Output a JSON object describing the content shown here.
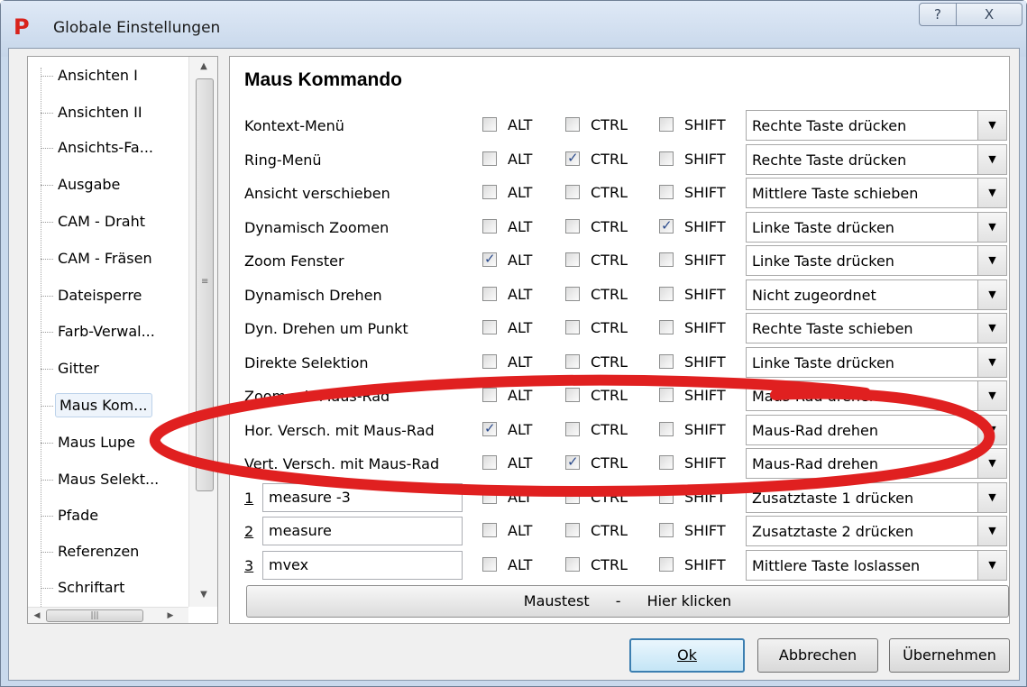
{
  "window": {
    "title": "Globale Einstellungen",
    "app_icon": "P",
    "help_glyph": "?",
    "close_glyph": "X"
  },
  "tree": {
    "items": [
      "Ansichten I",
      "Ansichten II",
      "Ansichts-Fa...",
      "Ausgabe",
      "CAM - Draht",
      "CAM - Fräsen",
      "Dateisperre",
      "Farb-Verwal...",
      "Gitter",
      "Maus Kom...",
      "Maus Lupe",
      "Maus Selekt...",
      "Pfade",
      "Referenzen",
      "Schriftart"
    ],
    "selected_index": 9
  },
  "panel": {
    "title": "Maus Kommando",
    "mod_labels": {
      "alt": "ALT",
      "ctrl": "CTRL",
      "shift": "SHIFT"
    },
    "rows": [
      {
        "label": "Kontext-Menü",
        "alt": false,
        "ctrl": false,
        "shift": false,
        "action": "Rechte Taste drücken"
      },
      {
        "label": "Ring-Menü",
        "alt": false,
        "ctrl": true,
        "shift": false,
        "action": "Rechte Taste drücken"
      },
      {
        "label": "Ansicht verschieben",
        "alt": false,
        "ctrl": false,
        "shift": false,
        "action": "Mittlere Taste schieben"
      },
      {
        "label": "Dynamisch Zoomen",
        "alt": false,
        "ctrl": false,
        "shift": true,
        "action": "Linke Taste drücken"
      },
      {
        "label": "Zoom Fenster",
        "alt": true,
        "ctrl": false,
        "shift": false,
        "action": "Linke Taste drücken"
      },
      {
        "label": "Dynamisch Drehen",
        "alt": false,
        "ctrl": false,
        "shift": false,
        "action": "Nicht zugeordnet"
      },
      {
        "label": "Dyn. Drehen um Punkt",
        "alt": false,
        "ctrl": false,
        "shift": false,
        "action": "Rechte Taste schieben"
      },
      {
        "label": "Direkte Selektion",
        "alt": false,
        "ctrl": false,
        "shift": false,
        "action": "Linke Taste drücken"
      },
      {
        "label": "Zoom mit Maus-Rad",
        "alt": false,
        "ctrl": false,
        "shift": false,
        "action": "Maus-Rad drehen"
      },
      {
        "label": "Hor. Versch. mit Maus-Rad",
        "alt": true,
        "ctrl": false,
        "shift": false,
        "action": "Maus-Rad drehen"
      },
      {
        "label": "Vert. Versch. mit Maus-Rad",
        "alt": false,
        "ctrl": true,
        "shift": false,
        "action": "Maus-Rad drehen"
      }
    ],
    "custom_rows": [
      {
        "num": "1",
        "value": "measure -3",
        "alt": false,
        "ctrl": false,
        "shift": false,
        "action": "Zusatztaste 1 drücken"
      },
      {
        "num": "2",
        "value": "measure",
        "alt": false,
        "ctrl": false,
        "shift": false,
        "action": "Zusatztaste 2 drücken"
      },
      {
        "num": "3",
        "value": "mvex",
        "alt": false,
        "ctrl": false,
        "shift": false,
        "action": "Mittlere Taste loslassen"
      }
    ],
    "test_button": {
      "left": "Maustest",
      "sep": "-",
      "right": "Hier klicken"
    }
  },
  "buttons": {
    "ok": "Ok",
    "cancel": "Abbrechen",
    "apply": "Übernehmen"
  },
  "annotation_color": "#e02020"
}
